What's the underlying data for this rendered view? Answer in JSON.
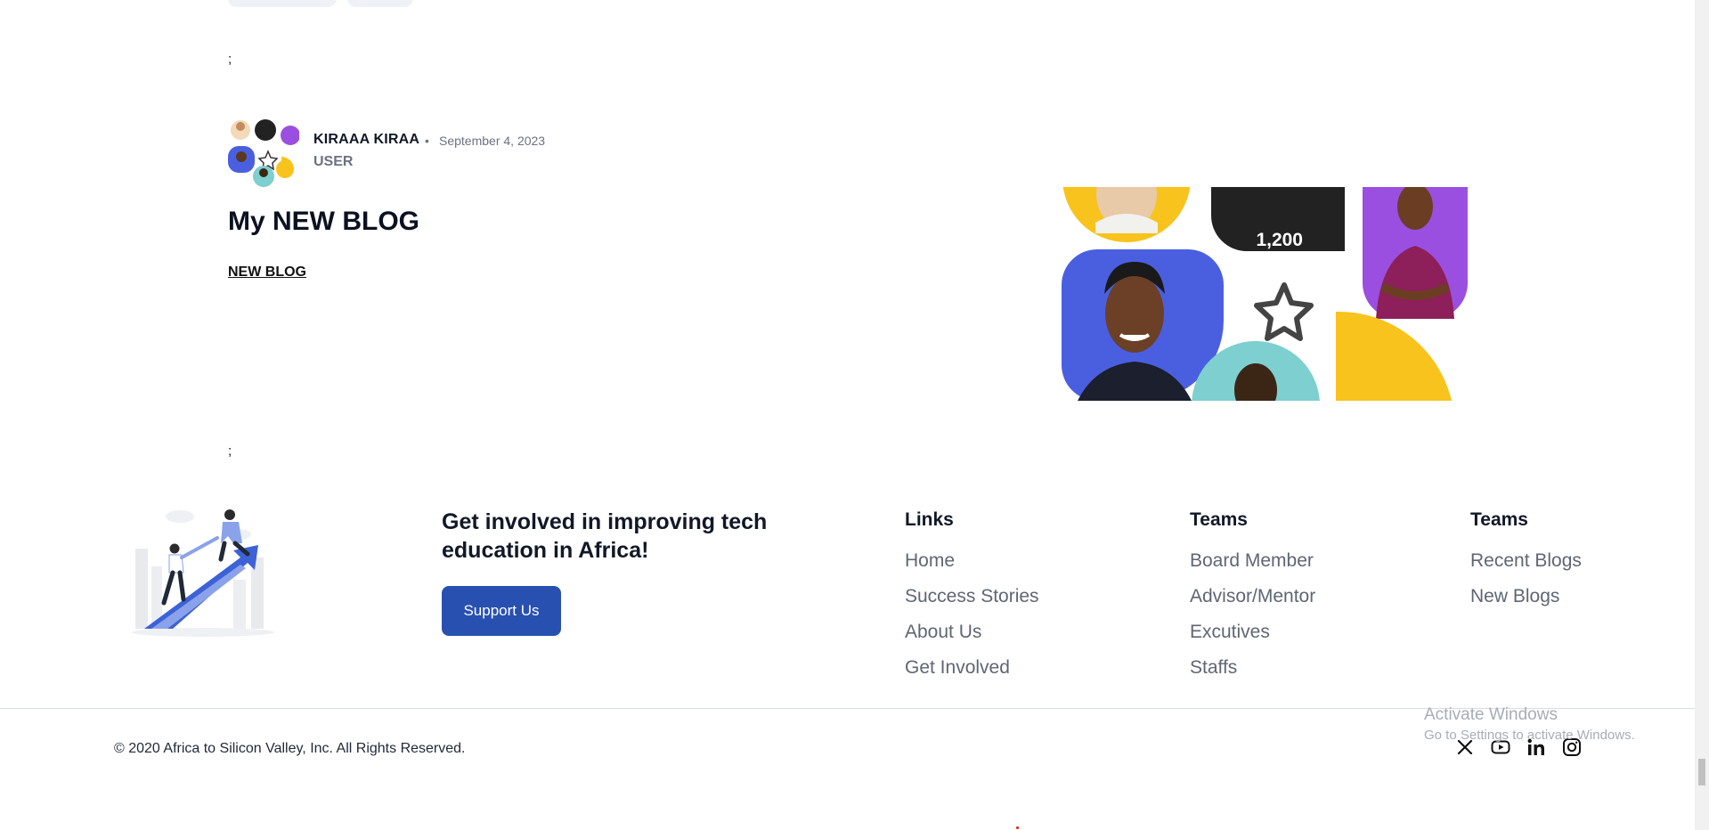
{
  "post": {
    "separator_top": ";",
    "author_name": "KIRAAA KIRAA",
    "dot": "•",
    "date": "September 4, 2023",
    "author_role": "USER",
    "title": "My NEW BLOG",
    "link_label": "NEW BLOG",
    "separator_bottom": ";",
    "collage_stat": "1,200"
  },
  "footer": {
    "cta_heading": "Get involved in improving tech education in Africa!",
    "support_button": "Support Us",
    "columns": [
      {
        "heading": "Links",
        "items": [
          "Home",
          "Success Stories",
          "About Us",
          "Get Involved"
        ]
      },
      {
        "heading": "Teams",
        "items": [
          "Board Member",
          "Advisor/Mentor",
          "Excutives",
          "Staffs"
        ]
      },
      {
        "heading": "Teams",
        "items": [
          "Recent Blogs",
          "New Blogs"
        ]
      }
    ],
    "copyright": "© 2020 Africa to Silicon Valley, Inc. All Rights Reserved.",
    "socials": [
      "x-icon",
      "youtube-icon",
      "linkedin-icon",
      "instagram-icon"
    ]
  },
  "os_overlay": {
    "activate_title": "Activate Windows",
    "activate_sub": "Go to Settings to activate Windows."
  },
  "colors": {
    "primary_button": "#2850b0",
    "collage_blue": "#4a5fe0",
    "collage_yellow": "#f8c31c",
    "collage_purple": "#9a4fe0",
    "collage_teal": "#7ecfcf"
  }
}
